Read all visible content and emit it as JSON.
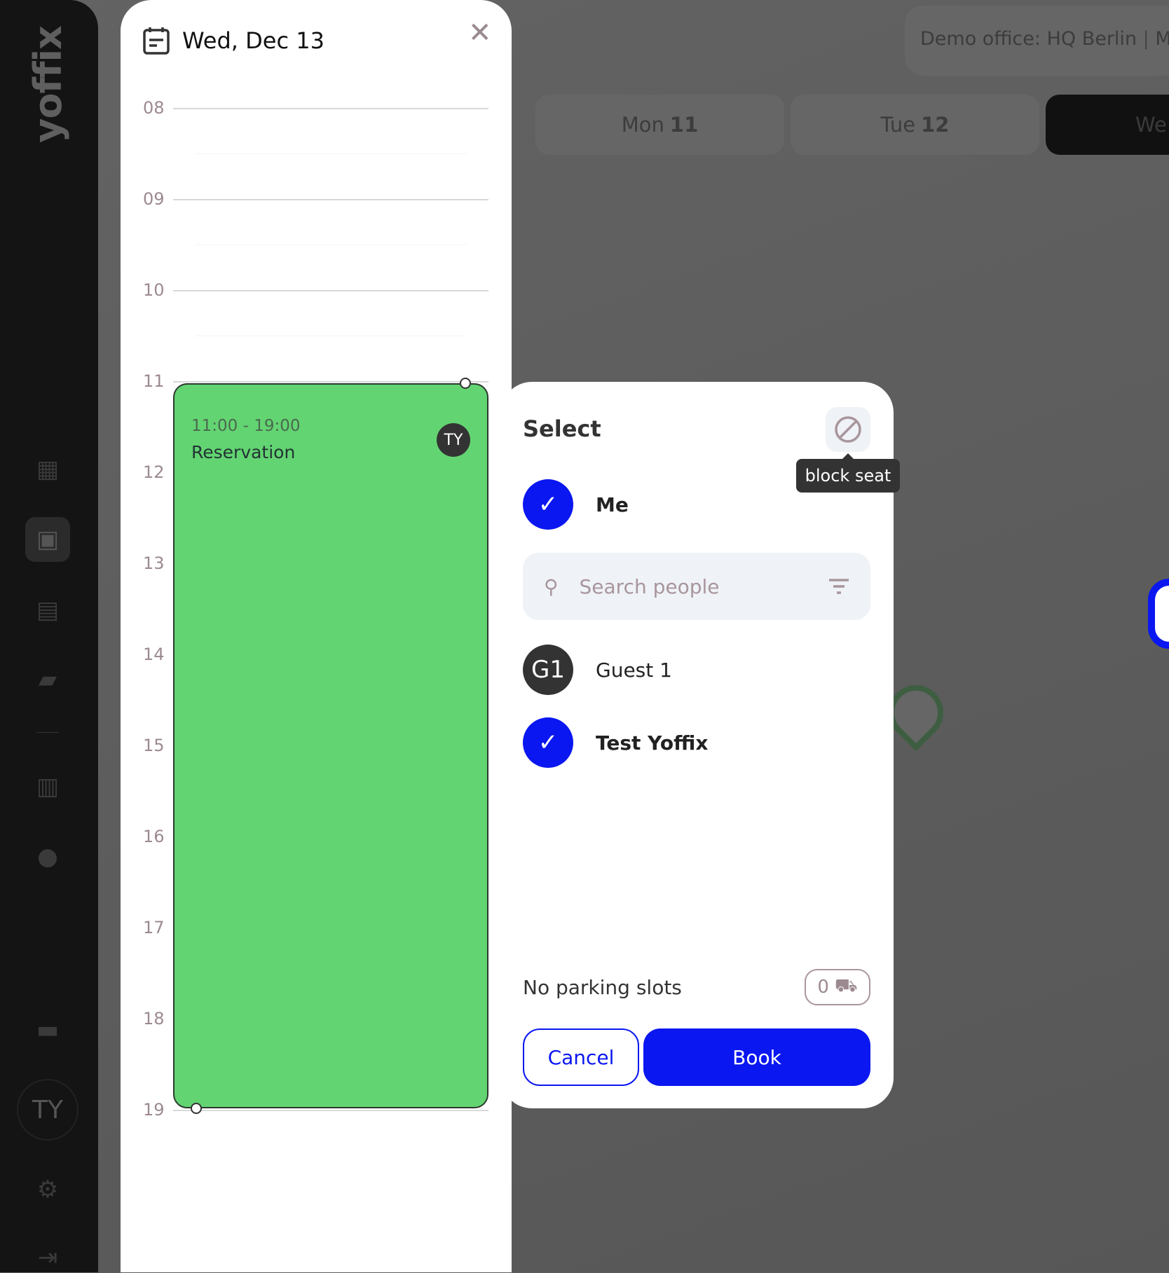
{
  "brand": {
    "logo": "yoffix"
  },
  "sidebar": {
    "items": [
      {
        "icon": "dashboard-icon"
      },
      {
        "icon": "floor-map-icon",
        "active": true
      },
      {
        "icon": "calendar-icon"
      },
      {
        "icon": "chat-icon"
      },
      {
        "icon": "building-icon"
      },
      {
        "icon": "people-icon"
      },
      {
        "icon": "inbox-icon"
      }
    ],
    "avatar": "TY",
    "settings_icon": "gear-icon",
    "logout_icon": "logout-icon"
  },
  "header": {
    "office": "Demo office: HQ Berlin",
    "office_next": "M",
    "days": [
      {
        "name": "Mon",
        "num": "11"
      },
      {
        "name": "Tue",
        "num": "12"
      },
      {
        "name": "We",
        "num": ""
      }
    ]
  },
  "calendar": {
    "title": "Wed, Dec 13",
    "hours": [
      "08",
      "09",
      "10",
      "11",
      "12",
      "13",
      "14",
      "15",
      "16",
      "17",
      "18",
      "19"
    ],
    "event": {
      "time": "11:00 - 19:00",
      "title": "Reservation",
      "avatar": "TY",
      "color": "#63d472"
    }
  },
  "select": {
    "title": "Select",
    "block_tooltip": "block seat",
    "me": {
      "label": "Me",
      "selected": true
    },
    "search_placeholder": "Search people",
    "people": [
      {
        "initials": "G1",
        "name": "Guest 1",
        "selected": false
      },
      {
        "initials": "",
        "name": "Test Yoffix",
        "selected": true
      }
    ],
    "parking_label": "No parking slots",
    "parking_count": "0",
    "cancel": "Cancel",
    "book": "Book"
  },
  "colors": {
    "accent": "#0a17f0",
    "event": "#63d472"
  }
}
